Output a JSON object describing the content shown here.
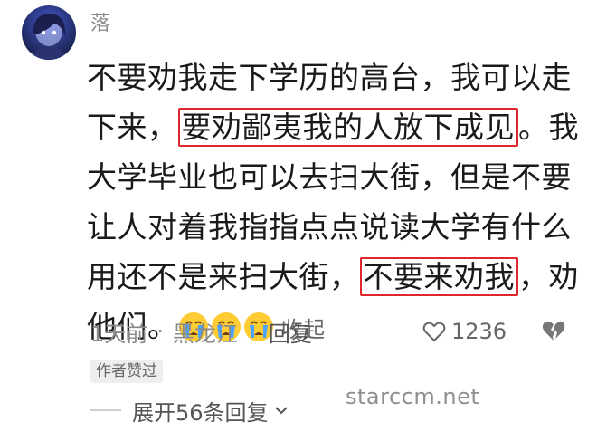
{
  "comment": {
    "username": "落",
    "content_lines": [
      [
        "不要劝我走下学历的高台，我可以走"
      ],
      [
        "下来，",
        "要劝鄙夷我的人放下成见",
        "。我"
      ],
      [
        "大学毕业也可以去扫大街，但是不要"
      ],
      [
        "让人对着我指指点点说读大学有什么"
      ],
      [
        "用还不是来扫大街，",
        "不要来劝我",
        "，劝"
      ],
      [
        "他们。"
      ]
    ],
    "emoji": [
      "crying-face-icon",
      "crying-face-icon",
      "crying-face-icon"
    ],
    "collapse_label": "收起",
    "time": "1天前",
    "separator": "·",
    "location": "黑龙江",
    "reply_label": "回复",
    "likes": "1236",
    "author_badge": "作者赞过",
    "expand_label": "展开56条回复"
  },
  "watermark": "starccm.net",
  "colors": {
    "highlight_border": "#e0262c",
    "meta_text": "#8a8a8a"
  }
}
